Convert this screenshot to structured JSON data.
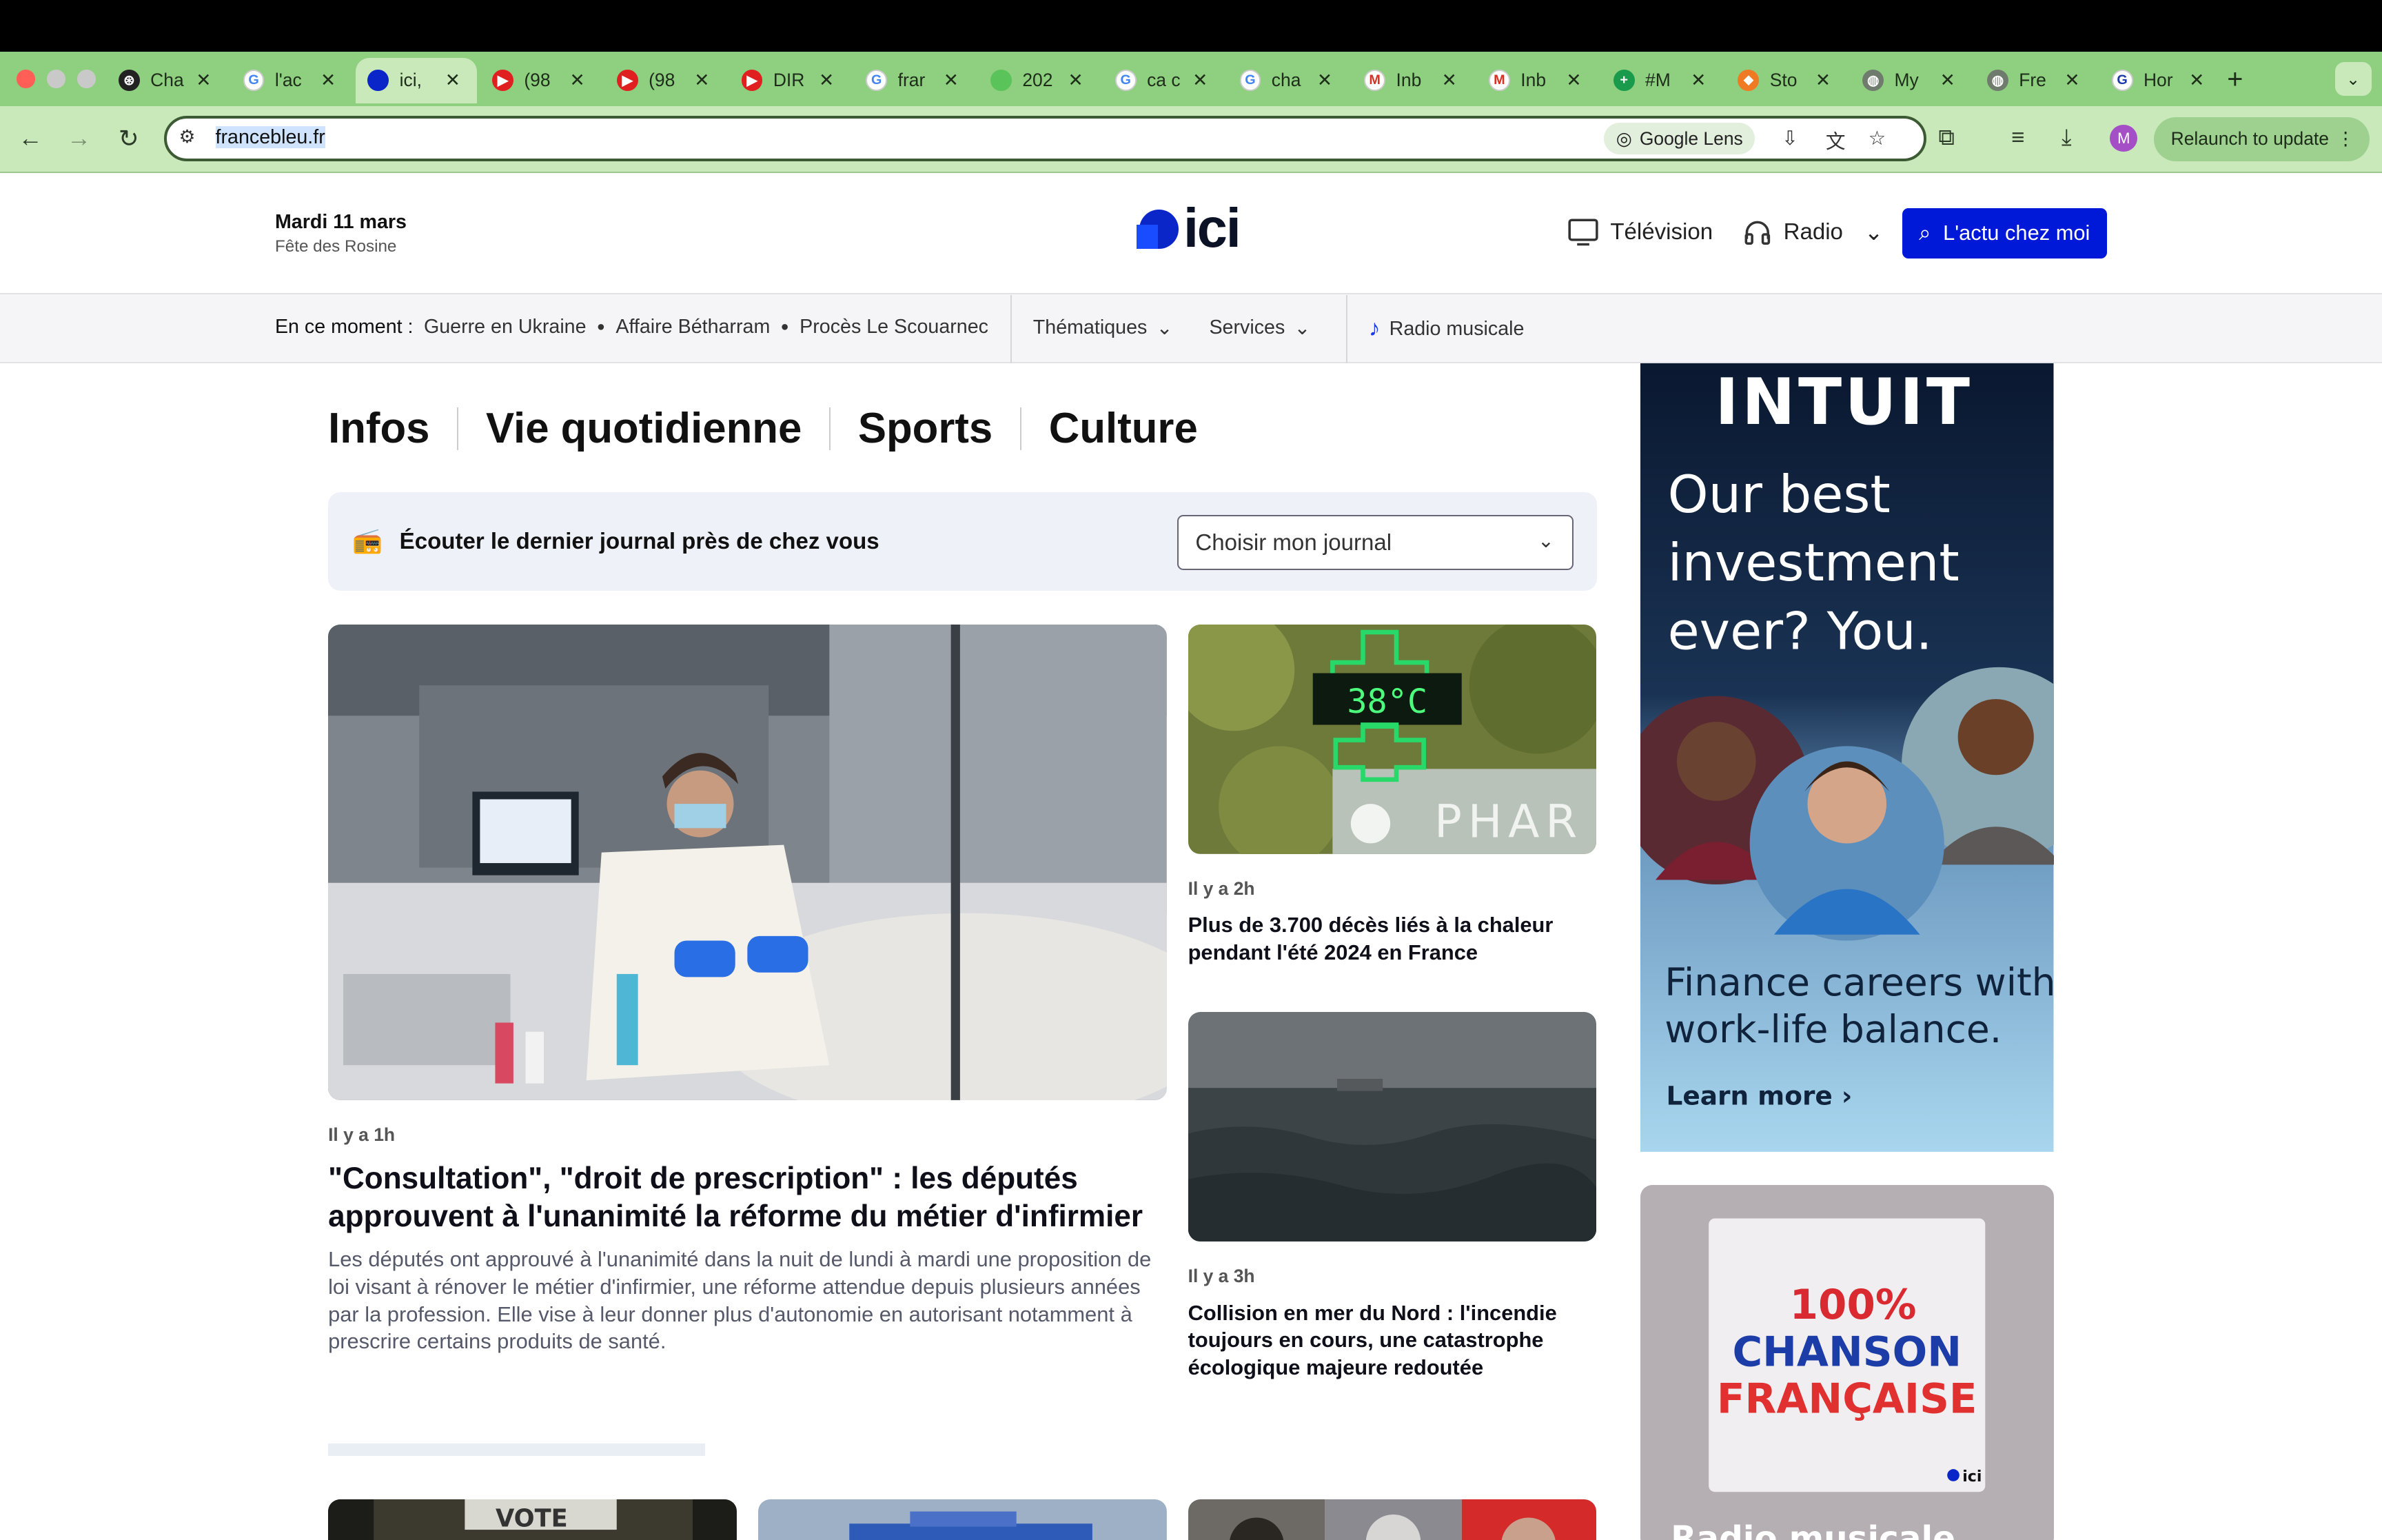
{
  "browser": {
    "tabs": [
      {
        "title": "Cha",
        "icon": "openai-icon"
      },
      {
        "title": "l'ac",
        "icon": "google-icon"
      },
      {
        "title": "ici,",
        "icon": "ici-icon"
      },
      {
        "title": "(98",
        "icon": "youtube-icon"
      },
      {
        "title": "(98",
        "icon": "youtube-icon"
      },
      {
        "title": "DIR",
        "icon": "youtube-icon"
      },
      {
        "title": "frar",
        "icon": "google-icon"
      },
      {
        "title": "202",
        "icon": "green-circle-icon"
      },
      {
        "title": "ca c",
        "icon": "google-icon"
      },
      {
        "title": "cha",
        "icon": "google-icon"
      },
      {
        "title": "Inb",
        "icon": "gmail-icon"
      },
      {
        "title": "Inb",
        "icon": "gmail-icon"
      },
      {
        "title": "#M",
        "icon": "sheets-icon"
      },
      {
        "title": "Sto",
        "icon": "orange-icon"
      },
      {
        "title": "My",
        "icon": "globe-icon"
      },
      {
        "title": "Fre",
        "icon": "globe-icon"
      },
      {
        "title": "Hor",
        "icon": "grammarly-icon"
      }
    ],
    "url": "francebleu.fr",
    "lens_label": "Google Lens",
    "relaunch_label": "Relaunch to update",
    "avatar_letter": "M"
  },
  "header": {
    "date": "Mardi 11 mars",
    "fete": "Fête des Rosine",
    "logo_text": "ici",
    "tv_label": "Télévision",
    "radio_label": "Radio",
    "cta_label": "L'actu chez moi"
  },
  "subnav": {
    "moment_label": "En ce moment :",
    "topics": [
      "Guerre en Ukraine",
      "Affaire Bétharram",
      "Procès Le Scouarnec"
    ],
    "thematiques": "Thématiques",
    "services": "Services",
    "radio_musicale": "Radio musicale"
  },
  "sections": [
    "Infos",
    "Vie quotidienne",
    "Sports",
    "Culture"
  ],
  "journal": {
    "label": "Écouter le dernier journal près de chez vous",
    "select_value": "Choisir mon journal"
  },
  "articles": {
    "main": {
      "time": "Il y a 1h",
      "title": "\"Consultation\", \"droit de prescription\" : les députés approuvent à l'unanimité la réforme du métier d'infirmier",
      "description": "Les députés ont approuvé à l'unanimité dans la nuit de lundi à mardi une proposition de loi visant à rénover le métier d'infirmier, une réforme attendue depuis plusieurs années par la profession. Elle vise à leur donner plus d'autonomie en autorisant notamment à prescrire certains produits de santé."
    },
    "side1": {
      "time": "Il y a 2h",
      "title": "Plus de 3.700 décès liés à la chaleur pendant l'été 2024 en France",
      "image_text": {
        "temp": "38°C",
        "sign": "PHAR"
      }
    },
    "side2": {
      "time": "Il y a 3h",
      "title": "Collision en mer du Nord : l'incendie toujours en cours, une catastrophe écologique majeure redoutée"
    },
    "bottom1_text": "VOTE"
  },
  "ad": {
    "brand": "INTUIT",
    "headline": "Our best investment ever? You.",
    "tagline": "Finance careers with work-life balance.",
    "link": "Learn more ›"
  },
  "radio_card": {
    "cover_line1": "100%",
    "cover_line2": "CHANSON",
    "cover_line3": "FRANÇAISE",
    "cover_logo": "ici",
    "title": "Radio musicale"
  },
  "colors": {
    "brand": "#0018d8",
    "tabstrip": "#8fcf80",
    "toolbar": "#c9e9bb"
  }
}
